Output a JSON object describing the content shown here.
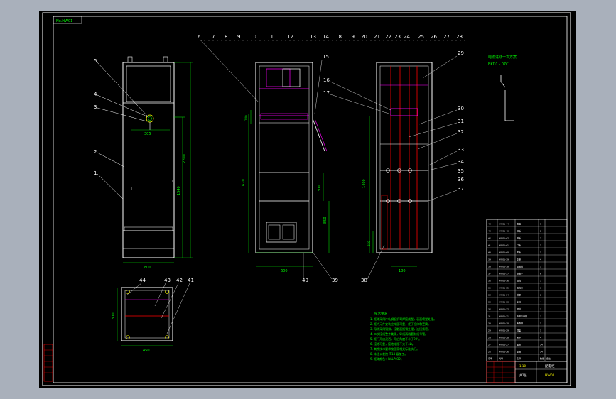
{
  "drawing": {
    "title_tag": "No.HW01",
    "colors": {
      "background": "#000000",
      "frame": "#ffffff",
      "outline": "#ffffff",
      "dimension": "#00ff00",
      "hidden": "#ff00ff",
      "center": "#ff0000",
      "cyan": "#00ffff",
      "text_note": "#00ff00",
      "yellow": "#ffff00",
      "viewport": "#a9b0bb"
    }
  },
  "labels": {
    "front": [
      "1",
      "2",
      "3",
      "4",
      "5"
    ],
    "side_top": [
      "6",
      "7",
      "8",
      "9",
      "10",
      "11",
      "12",
      "13",
      "14",
      "18",
      "19",
      "20",
      "21",
      "22",
      "23",
      "24",
      "25",
      "26",
      "27",
      "28"
    ],
    "side_right": [
      "15",
      "16",
      "17",
      "29",
      "30",
      "31",
      "32",
      "33",
      "34",
      "35",
      "36",
      "37"
    ],
    "bottom": [
      "38",
      "39",
      "40"
    ],
    "plan": [
      "41",
      "42",
      "43",
      "44"
    ]
  },
  "dimensions": {
    "front_width": "800",
    "front_height": "2200",
    "front_inner": "1540",
    "front_handle": "305",
    "side_width": "600",
    "side_height": "1670",
    "side_small": "300",
    "side_mid": "850",
    "side_top": "140",
    "rear_height": "1400",
    "rear_base": "250",
    "rear_width": "180",
    "plan_width": "450",
    "plan_depth": "300"
  },
  "schematic": {
    "line1": "电缆进线一次方案",
    "line2": "BKD1 - 07C"
  },
  "notes": {
    "title": "技术要求",
    "lines": [
      "1. 柜体采用冷轧钢板折弯焊接成型，表面喷塑处理。",
      "2. 柜内元件安装应牢固可靠，便于检修和更换。",
      "3. 母线采用铜排，接触面搪锡处理，连接紧密。",
      "4. 二次接线整齐美观，导线两端套有线号管。",
      "5. 柜门开启灵活，开启角度不小于90°。",
      "6. 接地可靠，接地电阻不大于4Ω。",
      "7. 其余技术要求按国家相关标准执行。",
      "8. 未注公差按 IT14 级加工。",
      "9. 柜体颜色：RAL7032。"
    ]
  },
  "parts_table": {
    "header": [
      "序号",
      "代号",
      "名称",
      "数量",
      "备注"
    ],
    "rows": [
      [
        "44",
        "HW01-44",
        "底框",
        "1",
        ""
      ],
      [
        "43",
        "HW01-43",
        "隔板",
        "2",
        ""
      ],
      [
        "42",
        "HW01-42",
        "侧板",
        "2",
        ""
      ],
      [
        "41",
        "HW01-41",
        "门板",
        "1",
        ""
      ],
      [
        "40",
        "HW01-40",
        "底板",
        "1",
        ""
      ],
      [
        "39",
        "HW01-39",
        "支架",
        "4",
        ""
      ],
      [
        "38",
        "HW01-38",
        "接地排",
        "1",
        ""
      ],
      [
        "37",
        "HW01-37",
        "绝缘子",
        "6",
        ""
      ],
      [
        "36",
        "HW01-36",
        "母线",
        "3",
        ""
      ],
      [
        "35",
        "HW01-35",
        "母线夹",
        "6",
        ""
      ],
      [
        "34",
        "HW01-34",
        "横梁",
        "2",
        ""
      ],
      [
        "33",
        "HW01-33",
        "立柱",
        "4",
        ""
      ],
      [
        "32",
        "HW01-32",
        "铜排",
        "3",
        ""
      ],
      [
        "31",
        "HW01-31",
        "电流互感器",
        "3",
        ""
      ],
      [
        "30",
        "HW01-30",
        "断路器",
        "1",
        ""
      ],
      [
        "29",
        "HW01-29",
        "顶盖",
        "1",
        ""
      ],
      [
        "28",
        "HW01-28",
        "吊环",
        "4",
        ""
      ],
      [
        "27",
        "HW01-27",
        "螺栓",
        "24",
        ""
      ],
      [
        "26",
        "HW01-26",
        "垫圈",
        "24",
        ""
      ]
    ],
    "title_block": {
      "name": "配电柜",
      "drawing_no": "HW01",
      "scale": "1:10",
      "sheet": "共1张"
    }
  }
}
